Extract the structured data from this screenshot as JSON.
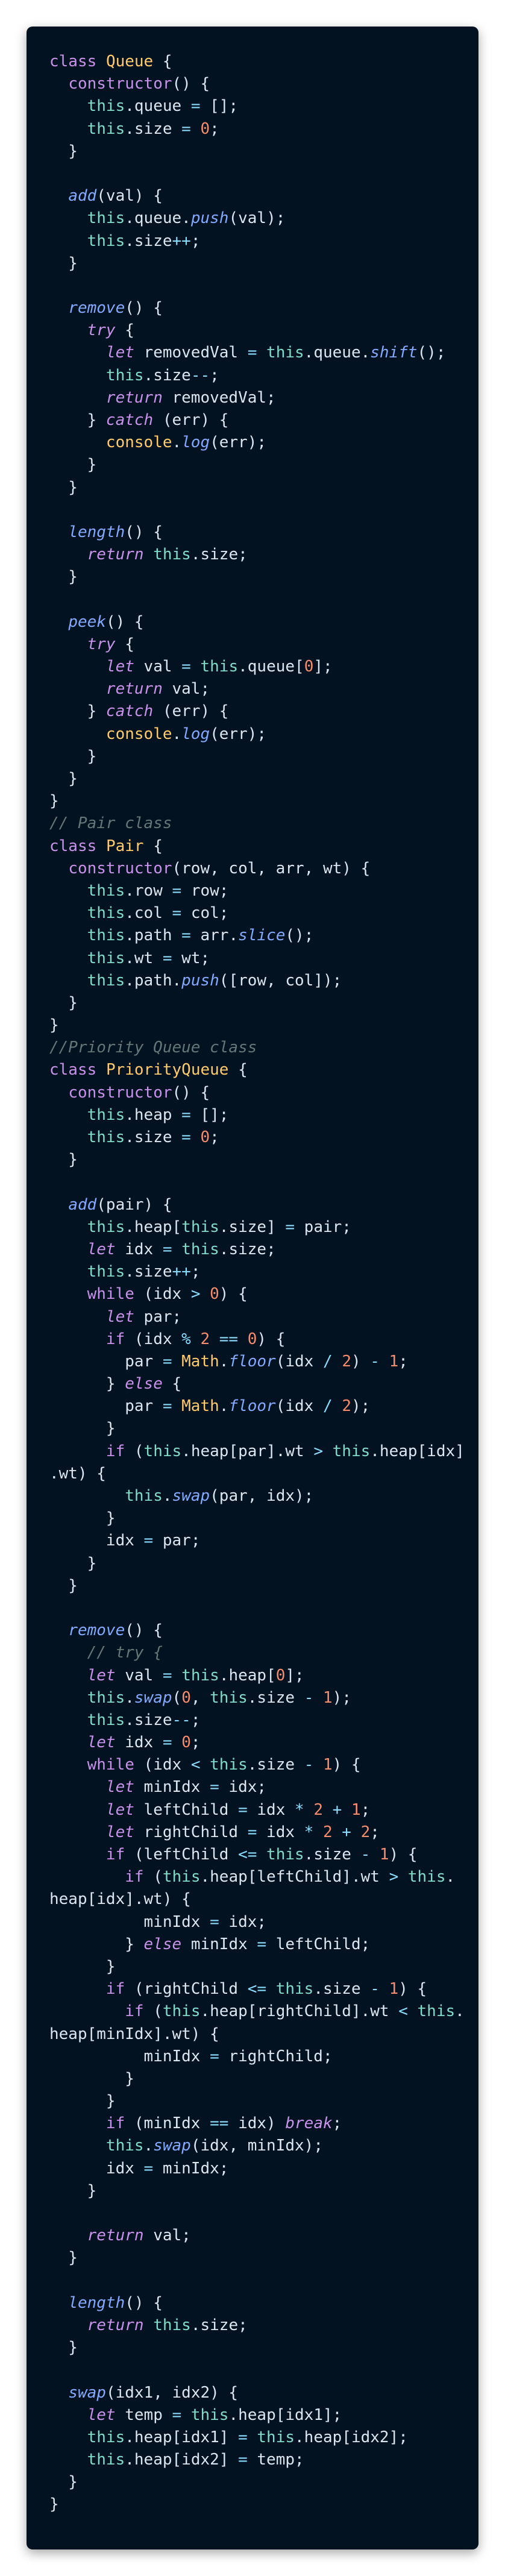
{
  "code_lines": [
    "class Queue {",
    "  constructor() {",
    "    this.queue = [];",
    "    this.size = 0;",
    "  }",
    "",
    "  add(val) {",
    "    this.queue.push(val);",
    "    this.size++;",
    "  }",
    "",
    "  remove() {",
    "    try {",
    "      let removedVal = this.queue.shift();",
    "      this.size--;",
    "      return removedVal;",
    "    } catch (err) {",
    "      console.log(err);",
    "    }",
    "  }",
    "",
    "  length() {",
    "    return this.size;",
    "  }",
    "",
    "  peek() {",
    "    try {",
    "      let val = this.queue[0];",
    "      return val;",
    "    } catch (err) {",
    "      console.log(err);",
    "    }",
    "  }",
    "}",
    "// Pair class",
    "class Pair {",
    "  constructor(row, col, arr, wt) {",
    "    this.row = row;",
    "    this.col = col;",
    "    this.path = arr.slice();",
    "    this.wt = wt;",
    "    this.path.push([row, col]);",
    "  }",
    "}",
    "//Priority Queue class",
    "class PriorityQueue {",
    "  constructor() {",
    "    this.heap = [];",
    "    this.size = 0;",
    "  }",
    "",
    "  add(pair) {",
    "    this.heap[this.size] = pair;",
    "    let idx = this.size;",
    "    this.size++;",
    "    while (idx > 0) {",
    "      let par;",
    "      if (idx % 2 == 0) {",
    "        par = Math.floor(idx / 2) - 1;",
    "      } else {",
    "        par = Math.floor(idx / 2);",
    "      }",
    "      if (this.heap[par].wt > this.heap[idx]",
    ".wt) {",
    "        this.swap(par, idx);",
    "      }",
    "      idx = par;",
    "    }",
    "  }",
    "",
    "  remove() {",
    "    // try {",
    "    let val = this.heap[0];",
    "    this.swap(0, this.size - 1);",
    "    this.size--;",
    "    let idx = 0;",
    "    while (idx < this.size - 1) {",
    "      let minIdx = idx;",
    "      let leftChild = idx * 2 + 1;",
    "      let rightChild = idx * 2 + 2;",
    "      if (leftChild <= this.size - 1) {",
    "        if (this.heap[leftChild].wt > this.",
    "heap[idx].wt) {",
    "          minIdx = idx;",
    "        } else minIdx = leftChild;",
    "      }",
    "      if (rightChild <= this.size - 1) {",
    "        if (this.heap[rightChild].wt < this.",
    "heap[minIdx].wt) {",
    "          minIdx = rightChild;",
    "        }",
    "      }",
    "      if (minIdx == idx) break;",
    "      this.swap(idx, minIdx);",
    "      idx = minIdx;",
    "    }",
    "",
    "    return val;",
    "  }",
    "",
    "  length() {",
    "    return this.size;",
    "  }",
    "",
    "  swap(idx1, idx2) {",
    "    let temp = this.heap[idx1];",
    "    this.heap[idx1] = this.heap[idx2];",
    "    this.heap[idx2] = temp;",
    "  }",
    "}"
  ],
  "theme": {
    "background": "#031220",
    "text": "#dce6f0",
    "keyword": "#c792ea",
    "class_name": "#ffcb6b",
    "function": "#82aaff",
    "this": "#7fdbca",
    "number": "#f78c6c",
    "comment": "#637777"
  }
}
